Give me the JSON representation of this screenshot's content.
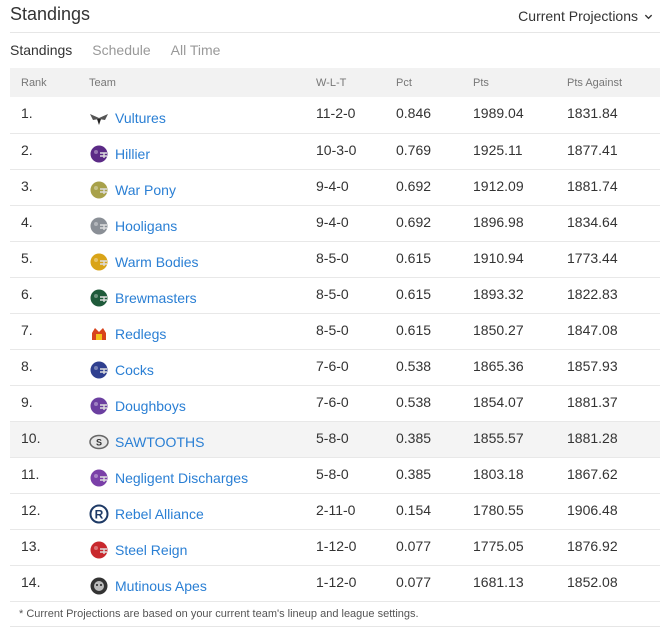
{
  "header": {
    "title": "Standings",
    "projection_label": "Current Projections"
  },
  "tabs": [
    {
      "label": "Standings",
      "active": true
    },
    {
      "label": "Schedule",
      "active": false
    },
    {
      "label": "All Time",
      "active": false
    }
  ],
  "columns": {
    "rank": "Rank",
    "team": "Team",
    "wlt": "W-L-T",
    "pct": "Pct",
    "pts": "Pts",
    "pts_against": "Pts Against"
  },
  "rows": [
    {
      "rank": "1.",
      "team": "Vultures",
      "wlt": "11-2-0",
      "pct": "0.846",
      "pts": "1989.04",
      "pts_against": "1831.84",
      "logo": "vultures-logo",
      "logo_color": "#555555"
    },
    {
      "rank": "2.",
      "team": "Hillier",
      "wlt": "10-3-0",
      "pct": "0.769",
      "pts": "1925.11",
      "pts_against": "1877.41",
      "logo": "helmet-logo",
      "logo_color": "#5b2a86"
    },
    {
      "rank": "3.",
      "team": "War Pony",
      "wlt": "9-4-0",
      "pct": "0.692",
      "pts": "1912.09",
      "pts_against": "1881.74",
      "logo": "helmet-logo",
      "logo_color": "#a8a14a"
    },
    {
      "rank": "4.",
      "team": "Hooligans",
      "wlt": "9-4-0",
      "pct": "0.692",
      "pts": "1896.98",
      "pts_against": "1834.64",
      "logo": "helmet-logo",
      "logo_color": "#8a8f96"
    },
    {
      "rank": "5.",
      "team": "Warm Bodies",
      "wlt": "8-5-0",
      "pct": "0.615",
      "pts": "1910.94",
      "pts_against": "1773.44",
      "logo": "helmet-logo",
      "logo_color": "#d9a418"
    },
    {
      "rank": "6.",
      "team": "Brewmasters",
      "wlt": "8-5-0",
      "pct": "0.615",
      "pts": "1893.32",
      "pts_against": "1822.83",
      "logo": "helmet-logo",
      "logo_color": "#1f5a3a"
    },
    {
      "rank": "7.",
      "team": "Redlegs",
      "wlt": "8-5-0",
      "pct": "0.615",
      "pts": "1850.27",
      "pts_against": "1847.08",
      "logo": "redlegs-logo",
      "logo_color": "#d8431c"
    },
    {
      "rank": "8.",
      "team": "Cocks",
      "wlt": "7-6-0",
      "pct": "0.538",
      "pts": "1865.36",
      "pts_against": "1857.93",
      "logo": "helmet-logo",
      "logo_color": "#2f3f8f"
    },
    {
      "rank": "9.",
      "team": "Doughboys",
      "wlt": "7-6-0",
      "pct": "0.538",
      "pts": "1854.07",
      "pts_against": "1881.37",
      "logo": "helmet-logo",
      "logo_color": "#6b3fa0"
    },
    {
      "rank": "10.",
      "team": "SAWTOOTHS",
      "wlt": "5-8-0",
      "pct": "0.385",
      "pts": "1855.57",
      "pts_against": "1881.28",
      "logo": "sawtooths-logo",
      "logo_color": "#666666",
      "highlight": true
    },
    {
      "rank": "11.",
      "team": "Negligent Discharges",
      "wlt": "5-8-0",
      "pct": "0.385",
      "pts": "1803.18",
      "pts_against": "1867.62",
      "logo": "helmet-logo",
      "logo_color": "#7a3fa8"
    },
    {
      "rank": "12.",
      "team": "Rebel Alliance",
      "wlt": "2-11-0",
      "pct": "0.154",
      "pts": "1780.55",
      "pts_against": "1906.48",
      "logo": "rebel-logo",
      "logo_color": "#1e3a66"
    },
    {
      "rank": "13.",
      "team": "Steel Reign",
      "wlt": "1-12-0",
      "pct": "0.077",
      "pts": "1775.05",
      "pts_against": "1876.92",
      "logo": "helmet-logo",
      "logo_color": "#c8282d"
    },
    {
      "rank": "14.",
      "team": "Mutinous Apes",
      "wlt": "1-12-0",
      "pct": "0.077",
      "pts": "1681.13",
      "pts_against": "1852.08",
      "logo": "apes-logo",
      "logo_color": "#333333"
    }
  ],
  "footnote": "* Current Projections are based on your current team's lineup and league settings."
}
